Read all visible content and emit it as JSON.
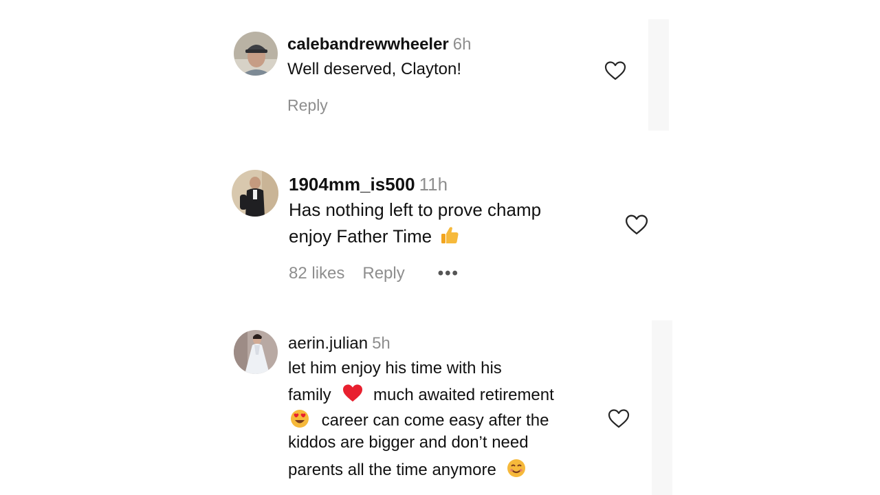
{
  "comments": [
    {
      "username": "calebandrewwheeler",
      "time": "6h",
      "lines": [
        "Well deserved, Clayton!"
      ],
      "reply_label": "Reply",
      "avatar_icon": "user-avatar-cap",
      "like_icon": "heart-outline-icon"
    },
    {
      "username": "1904mm_is500",
      "time": "11h",
      "lines": [
        "Has nothing left to prove champ",
        "enjoy Father Time"
      ],
      "likes_label": "82 likes",
      "reply_label": "Reply",
      "more_label": "•••",
      "avatar_icon": "user-avatar-suit",
      "like_icon": "heart-outline-icon",
      "emoji": "thumbs-up"
    },
    {
      "username": "aerin.julian",
      "time": "5h",
      "lines": [
        "let him enjoy his time with his",
        "family",
        "much awaited retirement",
        "career can come easy after the",
        "kiddos are bigger and don’t need",
        "parents all the time anymore"
      ],
      "avatar_icon": "user-avatar-dress",
      "like_icon": "heart-outline-icon",
      "emojis": [
        "red-heart",
        "heart-eyes-face",
        "smiling-face"
      ]
    }
  ],
  "colors": {
    "text": "#111111",
    "muted": "#8e8e8e",
    "heart_red": "#e8202f",
    "emoji_yellow": "#f6b93b"
  }
}
